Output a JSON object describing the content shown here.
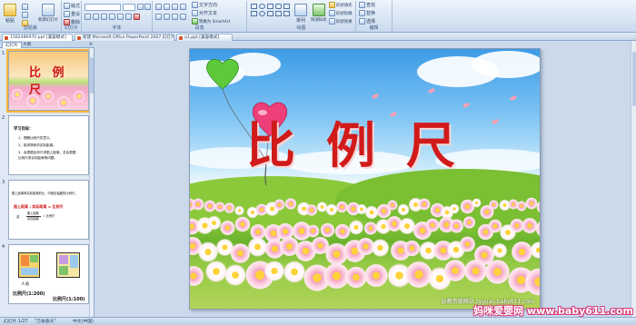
{
  "ribbon": {
    "groups": [
      {
        "id": "clipboard",
        "label": "剪贴板"
      },
      {
        "id": "slides",
        "label": "幻灯片"
      },
      {
        "id": "font",
        "label": "字体"
      },
      {
        "id": "paragraph",
        "label": "段落"
      },
      {
        "id": "drawing",
        "label": "绘图"
      },
      {
        "id": "editing",
        "label": "编辑"
      }
    ],
    "buttons": {
      "paste": "粘贴",
      "new_slide": "新建幻灯片",
      "layout": "版式",
      "reset": "重设",
      "delete": "删除",
      "text_direction": "文字方向",
      "align_text": "对齐文本",
      "smartart": "转换为 SmartArt",
      "arrange": "排列",
      "quick_styles": "快速样式",
      "shape_fill": "形状填充",
      "shape_outline": "形状轮廓",
      "shape_effects": "形状效果",
      "find": "查找",
      "replace": "替换",
      "select": "选择"
    }
  },
  "documents": [
    {
      "label": "1582486970.ppt [兼容模式]",
      "active": true
    },
    {
      "label": "新建 Microsoft Office PowerPoint 2007 幻灯片.pptx",
      "active": false
    },
    {
      "label": "a1.ppt [兼容模式]",
      "active": false
    }
  ],
  "pane": {
    "tabs": [
      "幻灯片",
      "大纲"
    ],
    "close": "×",
    "slide_numbers": [
      "1",
      "2",
      "3",
      "4"
    ],
    "thumb1_title": "比 例 尺",
    "thumb2": {
      "heading": "学习目标：",
      "items": [
        "1、理解比例尺的意义。",
        "2、能求物体的实际距离。",
        "3、会根据比例尺求图上距离，并会根据",
        "比例尺求实际距离等问题。"
      ]
    },
    "thumb3": {
      "intro": "图上距离和实际距离的比，叫做这幅图的比例尺。",
      "formula": "图上距离 : 实际距离 = 比例尺",
      "or_label": "或",
      "fraction_top": "图上距离",
      "fraction_bottom": "实际距离",
      "equals": "= 比例尺"
    },
    "thumb4": {
      "caption_a": "A 图",
      "ratio_a": "比例尺(1:200)",
      "ratio_b": "比例尺(1:100)"
    }
  },
  "slide": {
    "title": "比例尺",
    "site_text": "幼教资源网站 zyyuan.baby611.com"
  },
  "status": {
    "slide_counter": "幻灯片 1/27",
    "theme": "\"万泰春天\"",
    "language": "中文(中国)"
  },
  "watermark": "妈咪爱婴网 www.baby611.com",
  "colors": {
    "title_red": "#d11a1a",
    "ribbon_blue": "#1e395b",
    "selection_orange": "#f7b637"
  }
}
